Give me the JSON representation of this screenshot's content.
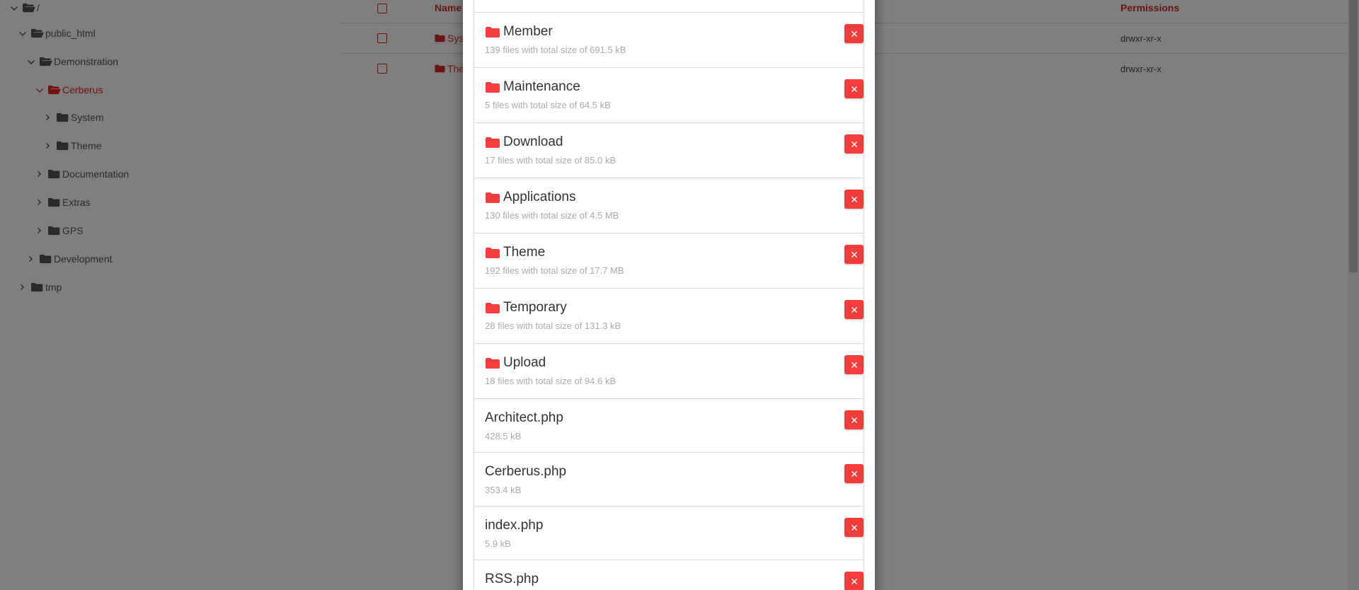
{
  "tree": {
    "items": [
      {
        "label": "/",
        "expanded": true,
        "open_folder": true,
        "active": false
      },
      {
        "label": "public_html",
        "expanded": true,
        "open_folder": true,
        "active": false
      },
      {
        "label": "Demonstration",
        "expanded": true,
        "open_folder": true,
        "active": false
      },
      {
        "label": "Cerberus",
        "expanded": true,
        "open_folder": true,
        "active": true
      },
      {
        "label": "System",
        "expanded": false,
        "open_folder": false,
        "active": false
      },
      {
        "label": "Theme",
        "expanded": false,
        "open_folder": false,
        "active": false
      },
      {
        "label": "Documentation",
        "expanded": false,
        "open_folder": false,
        "active": false
      },
      {
        "label": "Extras",
        "expanded": false,
        "open_folder": false,
        "active": false
      },
      {
        "label": "GPS",
        "expanded": false,
        "open_folder": false,
        "active": false
      },
      {
        "label": "Development",
        "expanded": false,
        "open_folder": false,
        "active": false
      },
      {
        "label": "tmp",
        "expanded": false,
        "open_folder": false,
        "active": false
      }
    ]
  },
  "table": {
    "headers": {
      "name": "Name",
      "permissions": "Permissions"
    },
    "rows": [
      {
        "name": "System",
        "permissions": "drwxr-xr-x"
      },
      {
        "name": "Theme",
        "permissions": "drwxr-xr-x"
      }
    ]
  },
  "modal": {
    "items": [
      {
        "title": "Member",
        "subtitle": "139 files with total size of 691.5 kB",
        "is_folder": true
      },
      {
        "title": "Maintenance",
        "subtitle": "5 files with total size of 64.5 kB",
        "is_folder": true
      },
      {
        "title": "Download",
        "subtitle": "17 files with total size of 85.0 kB",
        "is_folder": true
      },
      {
        "title": "Applications",
        "subtitle": "130 files with total size of 4.5 MB",
        "is_folder": true
      },
      {
        "title": "Theme",
        "subtitle": "192 files with total size of 17.7 MB",
        "is_folder": true
      },
      {
        "title": "Temporary",
        "subtitle": "28 files with total size of 131.3 kB",
        "is_folder": true
      },
      {
        "title": "Upload",
        "subtitle": "18 files with total size of 94.6 kB",
        "is_folder": true
      },
      {
        "title": "Architect.php",
        "subtitle": "428.5 kB",
        "is_folder": false
      },
      {
        "title": "Cerberus.php",
        "subtitle": "353.4 kB",
        "is_folder": false
      },
      {
        "title": "index.php",
        "subtitle": "5.9 kB",
        "is_folder": false
      },
      {
        "title": "RSS.php",
        "subtitle": "",
        "is_folder": false
      }
    ]
  },
  "colors": {
    "accent": "#e02424",
    "danger_button": "#f33d3d",
    "overlay": "rgba(0,0,0,0.5)"
  },
  "icons": {
    "remove": "close-icon",
    "folder": "folder-icon",
    "folder_open": "folder-open-icon",
    "chevron_down": "chevron-down-icon",
    "chevron_right": "chevron-right-icon"
  }
}
